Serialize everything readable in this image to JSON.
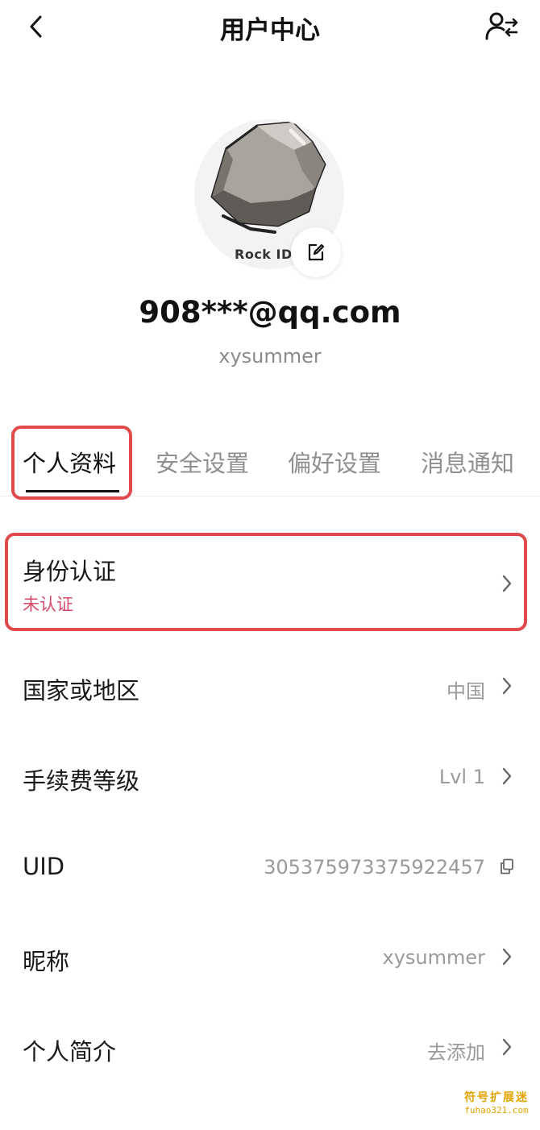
{
  "header": {
    "title": "用户中心",
    "back_icon": "chevron-left-icon",
    "switch_account_icon": "user-switch-icon"
  },
  "profile": {
    "avatar_label": "Rock ID",
    "edit_icon": "edit-icon",
    "email": "908***@qq.com",
    "username": "xysummer"
  },
  "tabs": [
    {
      "label": "个人资料",
      "active": true
    },
    {
      "label": "安全设置",
      "active": false
    },
    {
      "label": "偏好设置",
      "active": false
    },
    {
      "label": "消息通知",
      "active": false
    }
  ],
  "identity": {
    "label": "身份认证",
    "status": "未认证",
    "status_color": "#d84a6a"
  },
  "rows": [
    {
      "label": "国家或地区",
      "value": "中国",
      "icon": "chevron-right-icon"
    },
    {
      "label": "手续费等级",
      "value": "Lvl 1",
      "icon": "chevron-right-icon"
    },
    {
      "label": "UID",
      "value": "305375973375922457",
      "icon": "copy-icon"
    },
    {
      "label": "昵称",
      "value": "xysummer",
      "icon": "chevron-right-icon"
    },
    {
      "label": "个人简介",
      "value": "去添加",
      "icon": "chevron-right-icon"
    }
  ],
  "watermark": {
    "top": "符号扩展迷",
    "bottom": "fuhao321.com"
  },
  "colors": {
    "highlight_box": "#e04a4a",
    "accent_text": "#111111",
    "muted_text": "#9a9a9a"
  }
}
